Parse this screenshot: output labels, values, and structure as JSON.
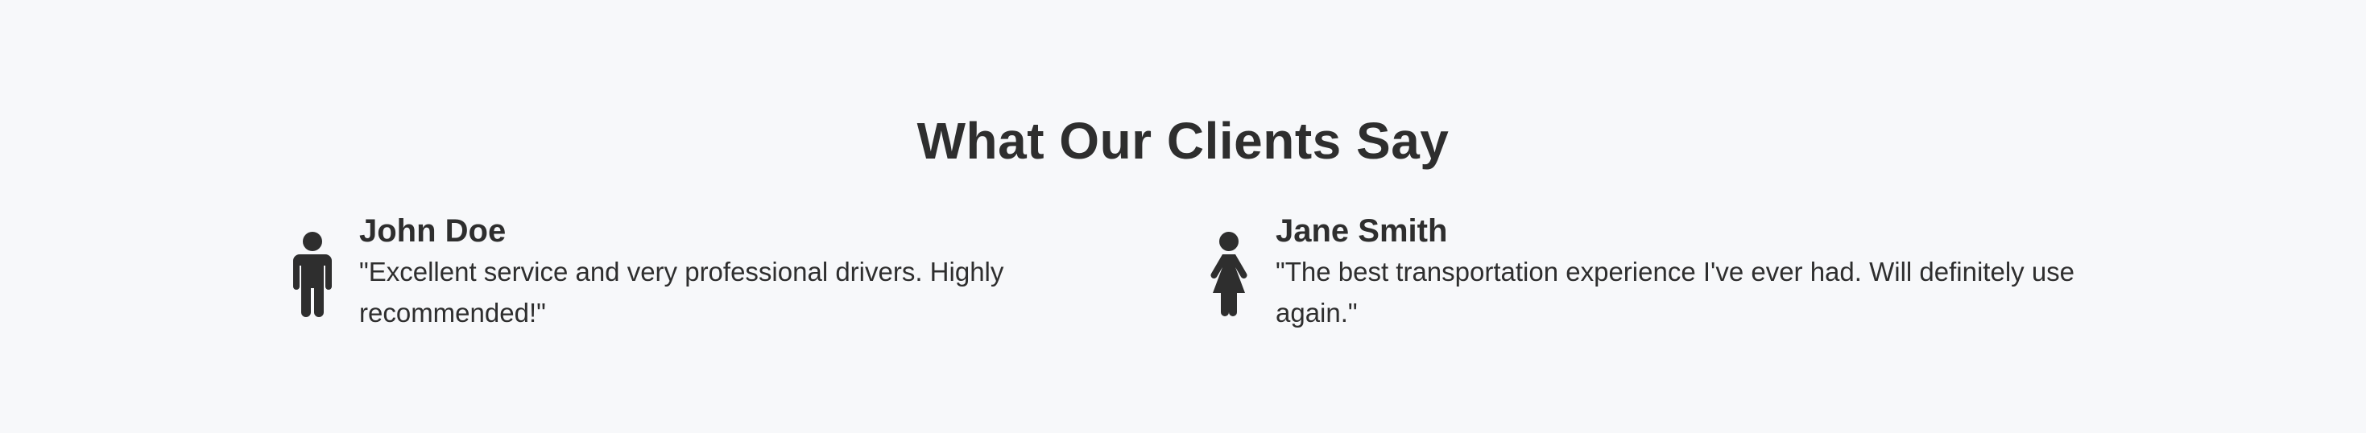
{
  "section": {
    "title": "What Our Clients Say"
  },
  "testimonials": [
    {
      "name": "John Doe",
      "quote": "\"Excellent service and very professional drivers. Highly recommended!\"",
      "icon": "male-icon"
    },
    {
      "name": "Jane Smith",
      "quote": "\"The best transportation experience I've ever had. Will definitely use again.\"",
      "icon": "female-icon"
    }
  ],
  "colors": {
    "background": "#f7f8fa",
    "text": "#2e2e2e"
  }
}
